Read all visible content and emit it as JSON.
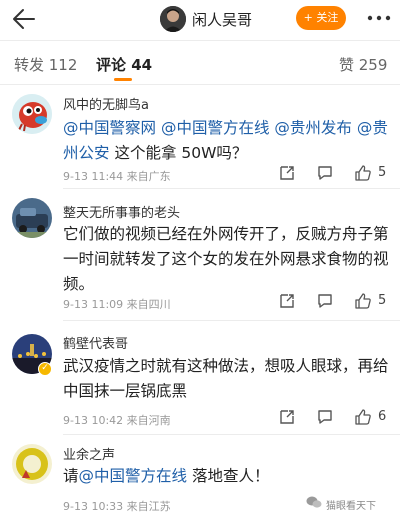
{
  "header": {
    "username": "闲人吴哥",
    "follow_label": "+ 关注"
  },
  "tabs": [
    {
      "label": "转发 112"
    },
    {
      "label": "评论 44"
    },
    {
      "label": "赞 259"
    }
  ],
  "comments": [
    {
      "name": "风中的无脚鸟a",
      "text_parts": [
        "@中国警察网",
        " ",
        "@中国警方在线",
        " ",
        "@贵州发布",
        " ",
        "@贵州公安",
        " 这个能拿 50W吗？"
      ],
      "meta": "9-13 11:44  来自广东",
      "likes": "5"
    },
    {
      "name": "整天无所事事的老头",
      "text": "它们做的视频已经在外网传开了，反贼方舟子第一时间就转发了这个女的发在外网悬求食物的视频。",
      "meta": "9-13 11:09  来自四川",
      "likes": "5"
    },
    {
      "name": "鹤壁代表哥",
      "text": "武汉疫情之时就有这种做法，想吸人眼球，再给中国抹一层锅底黑",
      "meta": "9-13 10:42  来自河南",
      "likes": "6"
    },
    {
      "name": "业余之声",
      "text_prefix": "请",
      "text_mention": "@中国警方在线",
      "text_suffix": " 落地查人！",
      "meta": "9-13 10:33  来自江苏"
    }
  ],
  "watermark": "猫眼看天下",
  "colors": {
    "accent": "#ff8200",
    "mention": "#1f5fa8",
    "meta": "#999999"
  }
}
